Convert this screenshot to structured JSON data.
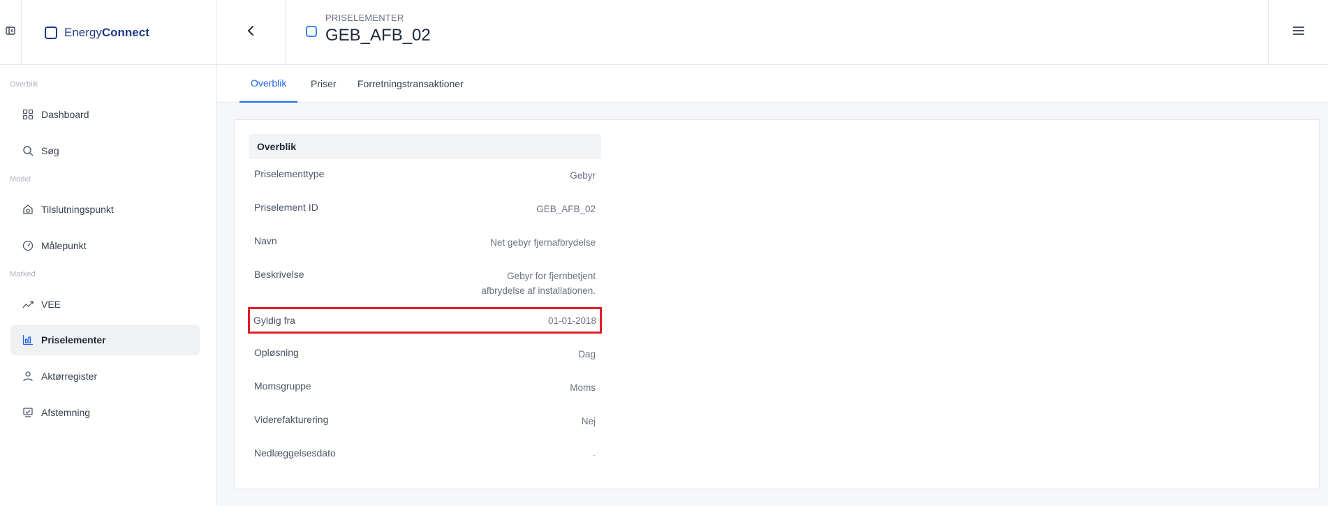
{
  "brand": {
    "name_part1": "Energy",
    "name_part2": "Connect"
  },
  "header": {
    "kicker": "PRISELEMENTER",
    "title": "GEB_AFB_02"
  },
  "sidebar": {
    "sections": [
      "Overblik",
      "Model",
      "Marked"
    ],
    "items": [
      {
        "label": "Dashboard",
        "icon": "grid-icon"
      },
      {
        "label": "Søg",
        "icon": "search-icon"
      },
      {
        "label": "Tilslutningspunkt",
        "icon": "house-plug-icon"
      },
      {
        "label": "Målepunkt",
        "icon": "gauge-icon"
      },
      {
        "label": "VEE",
        "icon": "trend-icon"
      },
      {
        "label": "Priselementer",
        "icon": "price-chart-icon",
        "active": true
      },
      {
        "label": "Aktørregister",
        "icon": "user-icon"
      },
      {
        "label": "Afstemning",
        "icon": "check-monitor-icon"
      }
    ]
  },
  "tabs": [
    "Overblik",
    "Priser",
    "Forretningstransaktioner"
  ],
  "card": {
    "title": "Overblik",
    "rows": [
      {
        "key": "Priselementtype",
        "value": "Gebyr"
      },
      {
        "key": "Priselement ID",
        "value": "GEB_AFB_02"
      },
      {
        "key": "Navn",
        "value": "Net gebyr fjernafbrydelse"
      },
      {
        "key": "Beskrivelse",
        "value_line1": "Gebyr for fjernbetjent",
        "value_line2": "afbrydelse af installationen."
      },
      {
        "key": "Gyldig fra",
        "value": "01-01-2018"
      },
      {
        "key": "Opløsning",
        "value": "Dag"
      },
      {
        "key": "Momsgruppe",
        "value": "Moms"
      },
      {
        "key": "Viderefakturering",
        "value": "Nej"
      },
      {
        "key": "Nedlæggelsesdato",
        "value": "-"
      }
    ]
  },
  "colors": {
    "brand": "#1e3a8a",
    "accent": "#2563eb",
    "highlight": "#e11d28"
  }
}
